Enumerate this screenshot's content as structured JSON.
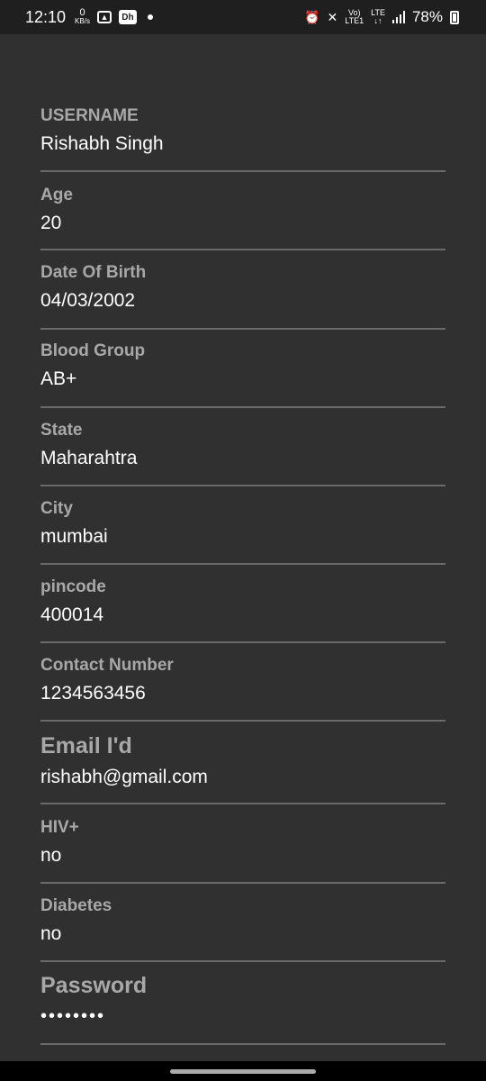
{
  "status_bar": {
    "time": "12:10",
    "net_speed_value": "0",
    "net_speed_unit": "KB/s",
    "dh_icon_text": "Dh",
    "volte": "Vo)",
    "lte_top": "LTE",
    "lte_bottom": "LTE1",
    "battery_percent": "78%"
  },
  "profile": {
    "fields": [
      {
        "label": "USERNAME",
        "value": "Rishabh Singh"
      },
      {
        "label": "Age",
        "value": "20"
      },
      {
        "label": "Date Of Birth",
        "value": "04/03/2002"
      },
      {
        "label": "Blood Group",
        "value": "AB+"
      },
      {
        "label": "State",
        "value": "Maharahtra"
      },
      {
        "label": "City",
        "value": "mumbai"
      },
      {
        "label": "pincode",
        "value": "400014"
      },
      {
        "label": "Contact Number",
        "value": "1234563456"
      },
      {
        "label": "Email I'd",
        "value": "rishabh@gmail.com"
      },
      {
        "label": "HIV+",
        "value": "no"
      },
      {
        "label": "Diabetes",
        "value": "no"
      },
      {
        "label": "Password",
        "value": "••••••••"
      }
    ]
  }
}
